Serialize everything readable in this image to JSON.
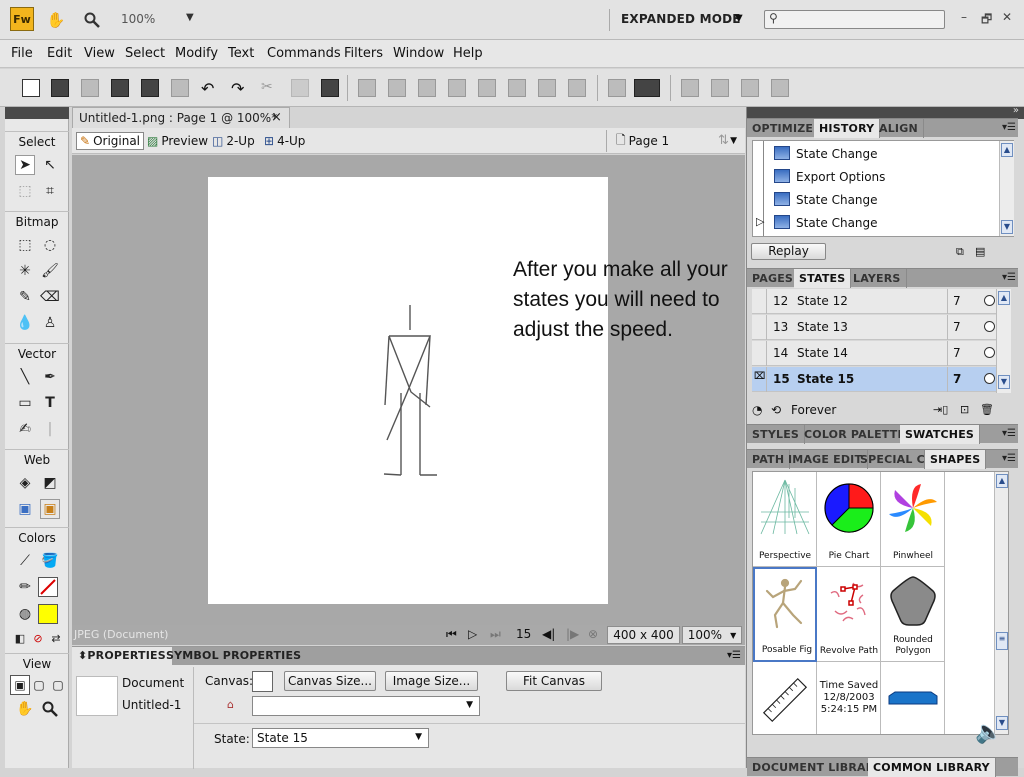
{
  "app": {
    "logo": "Fw",
    "zoom": "100%",
    "mode": "EXPANDED MODE",
    "search_placeholder": ""
  },
  "menu": [
    "File",
    "Edit",
    "View",
    "Select",
    "Modify",
    "Text",
    "Commands",
    "Filters",
    "Window",
    "Help"
  ],
  "tools": {
    "categories": [
      "Select",
      "Bitmap",
      "Vector",
      "Web",
      "Colors",
      "View"
    ]
  },
  "document": {
    "tab_title": "Untitled-1.png : Page 1 @ 100%*",
    "close": "×",
    "views": [
      "Original",
      "Preview",
      "2-Up",
      "4-Up"
    ],
    "page": "Page 1",
    "annotation": "After you make all your states you will need to adjust the speed."
  },
  "status": {
    "format": "JPEG (Document)",
    "frame": "15",
    "size": "400 x 400",
    "zoom": "100%"
  },
  "properties": {
    "tabs": [
      "PROPERTIES",
      "SYMBOL PROPERTIES"
    ],
    "doc_label": "Document",
    "doc_name": "Untitled-1",
    "canvas_label": "Canvas:",
    "canvas_size_btn": "Canvas Size...",
    "image_size_btn": "Image Size...",
    "fit_canvas_btn": "Fit Canvas",
    "state_label": "State:",
    "state_value": "State 15"
  },
  "panels": {
    "group1_tabs": [
      "OPTIMIZE",
      "HISTORY",
      "ALIGN"
    ],
    "history": [
      "State Change",
      "Export Options",
      "State Change",
      "State Change"
    ],
    "replay": "Replay",
    "group2_tabs": [
      "PAGES",
      "STATES",
      "LAYERS"
    ],
    "states": [
      {
        "num": "12",
        "name": "State 12",
        "delay": "7"
      },
      {
        "num": "13",
        "name": "State 13",
        "delay": "7"
      },
      {
        "num": "14",
        "name": "State 14",
        "delay": "7"
      },
      {
        "num": "15",
        "name": "State 15",
        "delay": "7"
      }
    ],
    "loop": "Forever",
    "group3_tabs": [
      "STYLES",
      "COLOR PALETTE",
      "SWATCHES"
    ],
    "group4_tabs": [
      "PATH",
      "IMAGE EDIT",
      "SPECIAL CH",
      "SHAPES"
    ],
    "shapes": [
      "Perspective",
      "Pie Chart",
      "Pinwheel",
      "Posable Fig",
      "Revolve Path",
      "Rounded Polygon"
    ],
    "time_saved": "Time Saved 12/8/2003 5:24:15 PM",
    "group5_tabs": [
      "DOCUMENT LIBRARY",
      "COMMON LIBRARY"
    ]
  }
}
